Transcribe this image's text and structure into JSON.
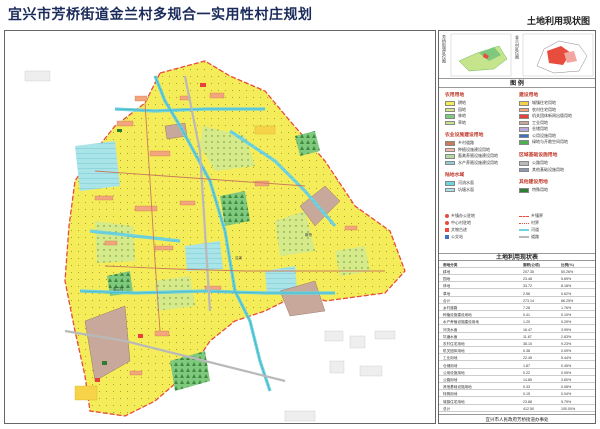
{
  "title": "宜兴市芳桥街道金兰村多规合一实用性村庄规划",
  "subtitle": "土地利用现状图",
  "location": {
    "left_label": "芳桥街道区位图",
    "right_label": "金兰村区位图"
  },
  "legend": {
    "heading": "图 例",
    "groups": [
      {
        "title": "农用用地",
        "items": [
          {
            "label": "耕地",
            "color": "#f5ec5a"
          },
          {
            "label": "园地",
            "color": "#d5ea8a"
          },
          {
            "label": "林地",
            "color": "#7fc97f"
          },
          {
            "label": "草地",
            "color": "#c6e48b"
          }
        ]
      },
      {
        "title": "农业设施建设用地",
        "items": [
          {
            "label": "乡村道路",
            "color": "#c97b5b"
          },
          {
            "label": "种植设施建设用地",
            "color": "#f6b9a8"
          },
          {
            "label": "畜禽养殖设施建设用地",
            "color": "#b5d8a0"
          },
          {
            "label": "水产养殖设施建设用地",
            "color": "#8fd0d8"
          }
        ]
      },
      {
        "title": "陆地水域",
        "items": [
          {
            "label": "河流水面",
            "color": "#6fd3e0"
          },
          {
            "label": "坑塘水面",
            "color": "#a8e4e8"
          }
        ]
      },
      {
        "title": "建设用地",
        "items": [
          {
            "label": "城镇住宅用地",
            "color": "#f7d34a"
          },
          {
            "label": "农村住宅用地",
            "color": "#f3a67d"
          },
          {
            "label": "机关团体新闻出版用地",
            "color": "#e8403a"
          },
          {
            "label": "工业用地",
            "color": "#c8a89a"
          },
          {
            "label": "仓储用地",
            "color": "#b9a9d8"
          },
          {
            "label": "公用设施用地",
            "color": "#3e70c4"
          },
          {
            "label": "绿地与开敞空间用地",
            "color": "#4caf50"
          }
        ]
      },
      {
        "title": "区域基础设施用地",
        "items": [
          {
            "label": "公路用地",
            "color": "#b9b9b9"
          },
          {
            "label": "其他基础设施用地",
            "color": "#8a9bb3"
          }
        ]
      },
      {
        "title": "其他建设用地",
        "items": [
          {
            "label": "特殊用地",
            "color": "#2e7d32"
          }
        ]
      }
    ]
  },
  "symbols": [
    {
      "label": "乡镇办公驻地",
      "color": "#e74c3c"
    },
    {
      "label": "中心村驻地",
      "color": "#e74c3c"
    },
    {
      "label": "文物古迹",
      "color": "#e74c3c"
    },
    {
      "label": "公交站",
      "color": "#3e70c4"
    },
    {
      "label": "乡镇界",
      "color": "#e74c3c"
    },
    {
      "label": "村界",
      "color": "#e74c3c"
    },
    {
      "label": "河道",
      "color": "#6fd3e0"
    },
    {
      "label": "道路",
      "color": "#b9b9b9"
    }
  ],
  "land_table": {
    "heading": "土地利用现状表",
    "columns": [
      "用地分类",
      "面积(公顷)",
      "比例(%)"
    ],
    "rows": [
      {
        "name": "耕地",
        "area": "207.35",
        "pct": "50.26%"
      },
      {
        "name": "园地",
        "area": "23.48",
        "pct": "5.69%"
      },
      {
        "name": "林地",
        "area": "33.72",
        "pct": "8.18%"
      },
      {
        "name": "草地",
        "area": "2.56",
        "pct": "0.62%"
      },
      {
        "name": "合计",
        "area": "273.14",
        "pct": "66.25%"
      },
      {
        "name": "乡村道路",
        "area": "7.28",
        "pct": "1.76%"
      },
      {
        "name": "种植设施建设用地",
        "area": "0.41",
        "pct": "0.10%"
      },
      {
        "name": "水产养殖设施建设用地",
        "area": "1.20",
        "pct": "0.29%"
      },
      {
        "name": "河流水面",
        "area": "16.47",
        "pct": "3.99%"
      },
      {
        "name": "坑塘水面",
        "area": "11.67",
        "pct": "2.83%"
      },
      {
        "name": "农村住宅用地",
        "area": "38.10",
        "pct": "9.23%"
      },
      {
        "name": "机关团体用地",
        "area": "0.38",
        "pct": "0.09%"
      },
      {
        "name": "工业用地",
        "area": "22.45",
        "pct": "5.44%"
      },
      {
        "name": "仓储用地",
        "area": "1.87",
        "pct": "0.45%"
      },
      {
        "name": "公用设施用地",
        "area": "0.22",
        "pct": "0.05%"
      },
      {
        "name": "公路用地",
        "area": "14.85",
        "pct": "3.60%"
      },
      {
        "name": "其他基础设施用地",
        "area": "0.33",
        "pct": "0.08%"
      },
      {
        "name": "特殊用地",
        "area": "0.15",
        "pct": "0.04%"
      },
      {
        "name": "城镇住宅用地",
        "area": "23.88",
        "pct": "5.79%"
      },
      {
        "name": "总计",
        "area": "412.50",
        "pct": "100.00%"
      }
    ]
  },
  "footer": "宜兴市人民政府芳桥街道办事处"
}
